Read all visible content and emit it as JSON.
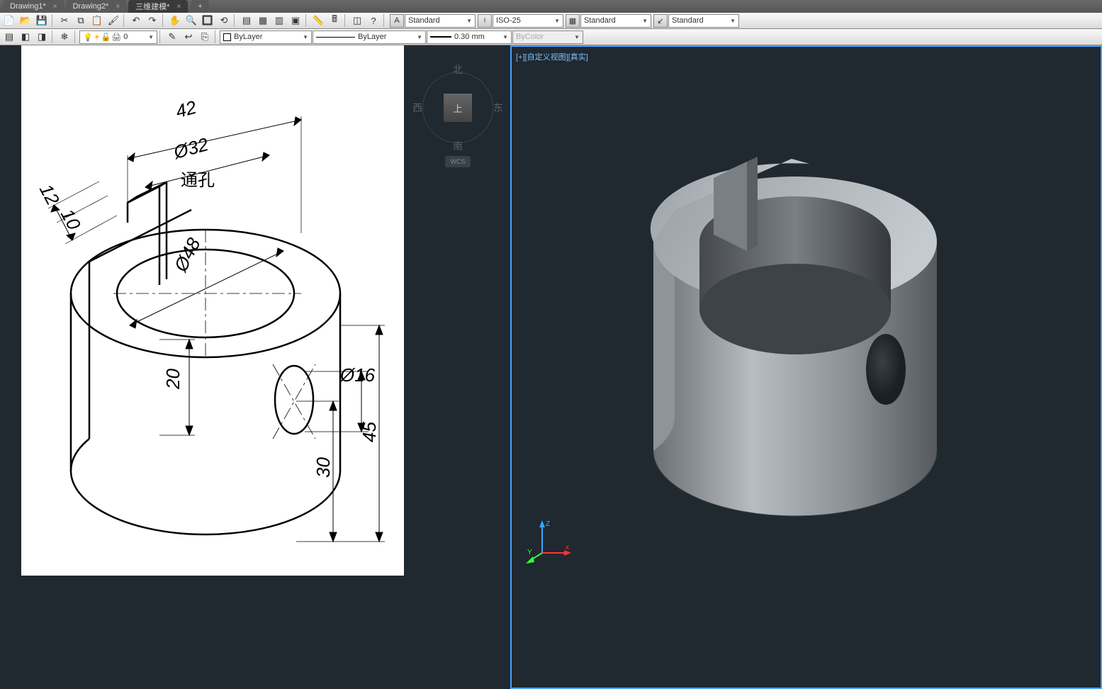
{
  "tabs": [
    {
      "label": "Drawing1*"
    },
    {
      "label": "Drawing2*"
    },
    {
      "label": "三维建模*"
    }
  ],
  "active_tab_index": 2,
  "toolbar1": {
    "text_style": "Standard",
    "dim_style": "ISO-25",
    "table_style": "Standard",
    "mleader_style": "Standard"
  },
  "toolbar2": {
    "layer_id": "0",
    "color": "ByLayer",
    "linetype": "ByLayer",
    "lineweight": "0.30 mm",
    "plotstyle": "ByColor"
  },
  "viewcube": {
    "north": "北",
    "south": "南",
    "east": "东",
    "west": "西",
    "top": "上",
    "wcs": "WCS"
  },
  "viewport_label": "[+][自定义视图][真实]",
  "drawing": {
    "dims": {
      "d42": "42",
      "d32": "Ø32",
      "through": "通孔",
      "d48": "Ø48",
      "d12": "12",
      "d10": "10",
      "d20": "20",
      "d16": "Ø16",
      "d30": "30",
      "d45": "45"
    }
  },
  "ucs": {
    "x": "x",
    "y": "Y",
    "z": "Z"
  }
}
